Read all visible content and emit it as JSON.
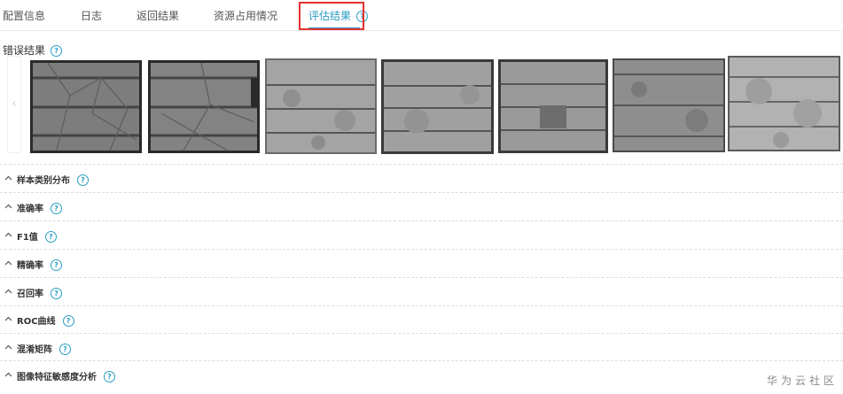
{
  "tabs": [
    {
      "label": "配置信息"
    },
    {
      "label": "日志"
    },
    {
      "label": "返回结果"
    },
    {
      "label": "资源占用情况"
    },
    {
      "label": "评估结果",
      "active": true
    }
  ],
  "help_glyph": "?",
  "error_results": {
    "title": "错误结果",
    "prev_arrow": "‹"
  },
  "sections": [
    {
      "label": "样本类别分布"
    },
    {
      "label": "准确率"
    },
    {
      "label": "F1值"
    },
    {
      "label": "精确率"
    },
    {
      "label": "召回率"
    },
    {
      "label": "ROC曲线"
    },
    {
      "label": "混淆矩阵"
    },
    {
      "label": "图像特征敏感度分析"
    }
  ],
  "watermark": "华为云社区",
  "colors": {
    "accent": "#2b9ec3",
    "highlight": "#e52f2f"
  }
}
